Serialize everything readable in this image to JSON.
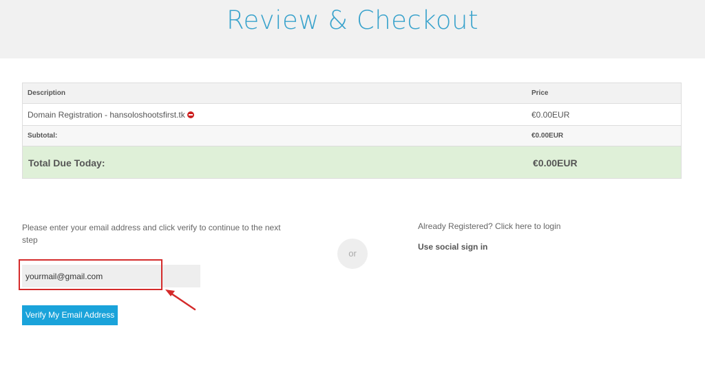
{
  "header": {
    "title": "Review & Checkout",
    "background_color": "#f1f1f1",
    "title_color": "#3aa3cc"
  },
  "cart": {
    "columns": [
      "Description",
      "Price"
    ],
    "items": [
      {
        "description": "Domain Registration - hansoloshootsfirst.tk",
        "price": "€0.00EUR",
        "remove_icon": "remove-icon"
      }
    ],
    "subtotal": {
      "label": "Subtotal:",
      "value": "€0.00EUR"
    },
    "total": {
      "label": "Total Due Today:",
      "value": "€0.00EUR",
      "background_color": "#dff0d8"
    }
  },
  "email_section": {
    "prompt": "Please enter your email address and click verify to continue to the next step",
    "email_value": "yourmail@gmail.com",
    "verify_button_label": "Verify My Email Address",
    "button_color": "#1aa3da",
    "highlight_color": "#d42a2a"
  },
  "divider": {
    "or_label": "or"
  },
  "login_section": {
    "login_link": "Already Registered? Click here to login",
    "social_signin": "Use social sign in"
  }
}
